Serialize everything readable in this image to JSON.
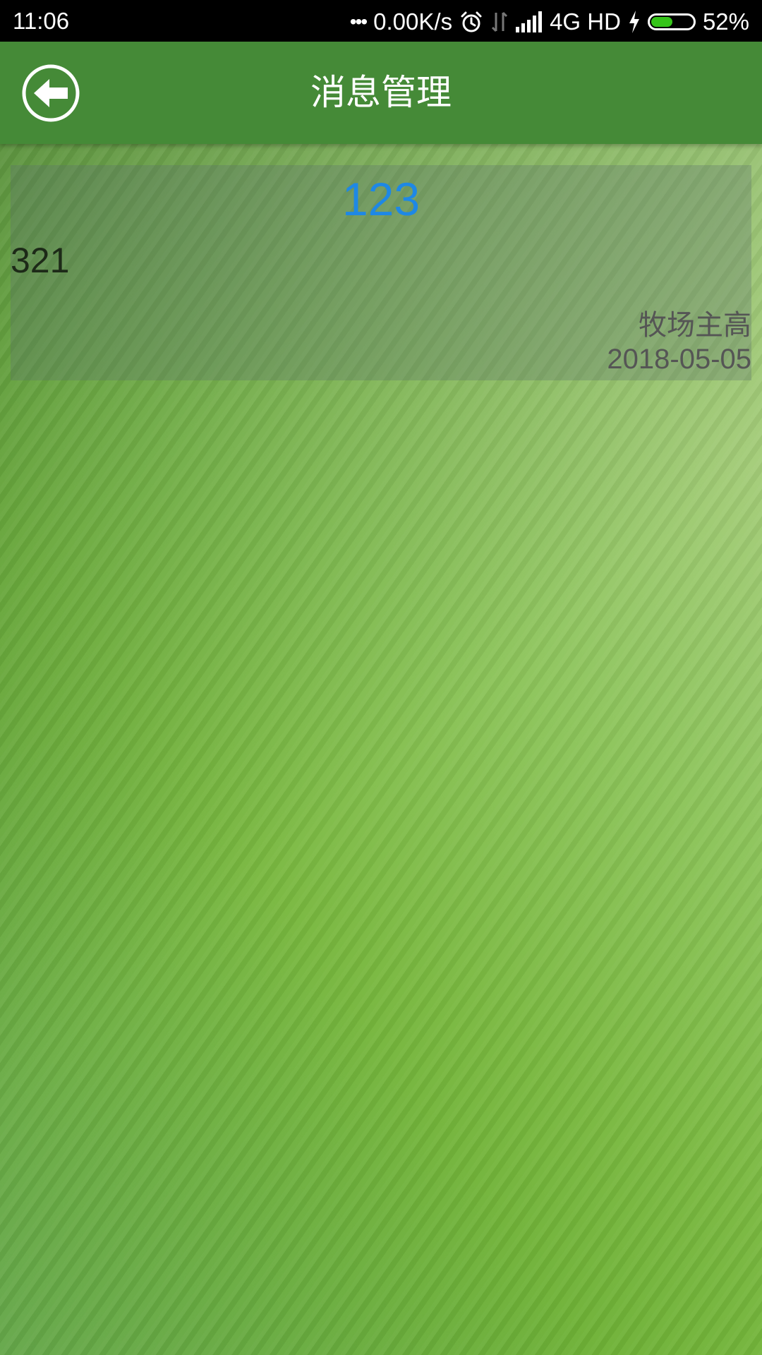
{
  "status_bar": {
    "time": "11:06",
    "dots": "•••",
    "network_speed": "0.00K/s",
    "network_type": "4G HD",
    "battery_percent": "52%",
    "battery_level": 0.52,
    "icons": [
      "alarm-icon",
      "data-transfer-icon",
      "signal-icon",
      "charging-icon",
      "battery-icon"
    ]
  },
  "header": {
    "title": "消息管理",
    "back_icon": "back-arrow-icon",
    "background_color": "#458a37"
  },
  "messages": [
    {
      "title": "123",
      "content": "321",
      "sender": "牧场主高",
      "date": "2018-05-05",
      "title_color": "#1e88e5"
    }
  ]
}
